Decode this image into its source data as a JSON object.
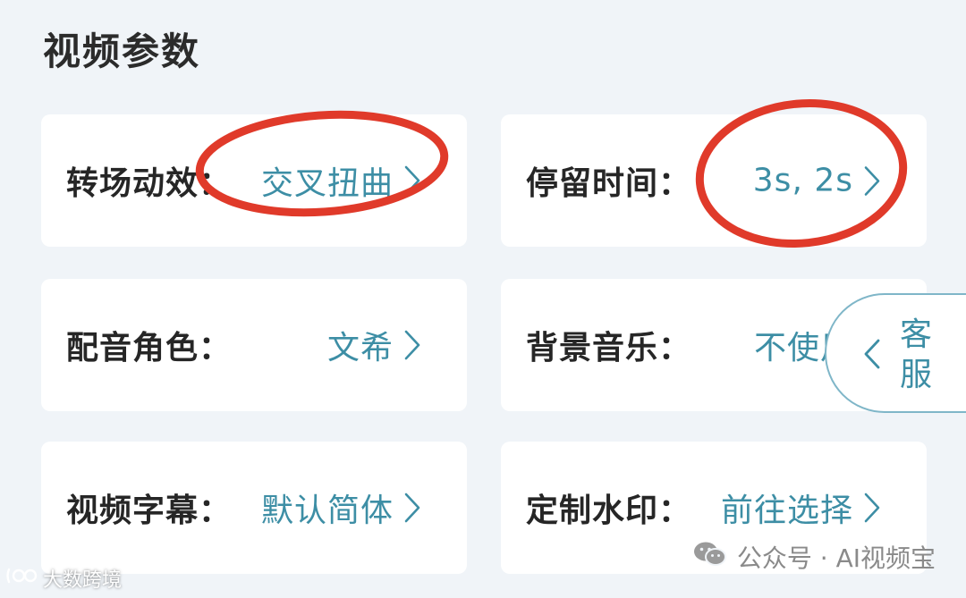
{
  "section": {
    "title": "视频参数"
  },
  "settings": [
    {
      "label": "转场动效：",
      "value": "交叉扭曲"
    },
    {
      "label": "停留时间：",
      "value": "3s, 2s"
    },
    {
      "label": "配音角色：",
      "value": "文希"
    },
    {
      "label": "背景音乐：",
      "value": "不使用"
    },
    {
      "label": "视频字幕：",
      "value": "默认简体"
    },
    {
      "label": "定制水印：",
      "value": "前往选择"
    }
  ],
  "service_tab": {
    "label": "客服"
  },
  "watermarks": {
    "wechat": "公众号 · AI视频宝",
    "corner": "大数跨境"
  },
  "colors": {
    "background": "#f0f4f8",
    "card": "#ffffff",
    "value_text": "#3d8ea5",
    "label_text": "#262626",
    "annotation_circle": "#e03a2a"
  },
  "icons": {
    "row_chevron": "chevron-right-icon",
    "service_chevron": "chevron-left-icon",
    "wechat": "wechat-icon"
  }
}
